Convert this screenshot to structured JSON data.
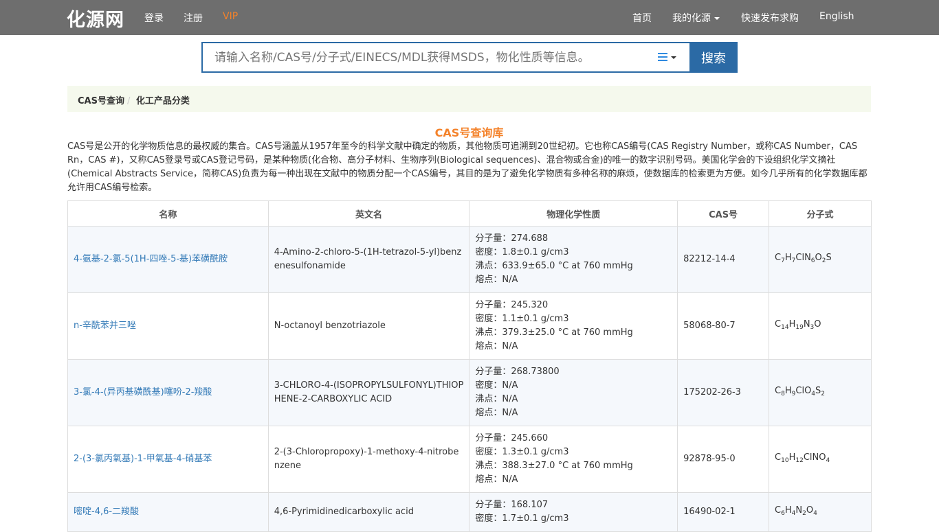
{
  "header": {
    "logo": "化源网",
    "nav_left": [
      "登录",
      "注册",
      "VIP"
    ],
    "nav_right": [
      "首页",
      "我的化源",
      "快速发布求购",
      "English"
    ]
  },
  "search": {
    "placeholder": "请输入名称/CAS号/分子式/EINECS/MDL获得MSDS，物化性质等信息。",
    "button": "搜索"
  },
  "breadcrumb": [
    "CAS号查询",
    "化工产品分类"
  ],
  "page_title": "CAS号查询库",
  "intro": "CAS号是公开的化学物质信息的最权威的集合。CAS号涵盖从1957年至今的科学文献中确定的物质，其他物质可追溯到20世纪初。它也称CAS编号(CAS Registry Number，或称CAS Number，CAS Rn，CAS #)，又称CAS登录号或CAS登记号码，是某种物质(化合物、高分子材料、生物序列(Biological sequences)、混合物或合金)的唯一的数字识别号码。美国化学会的下设组织化学文摘社(Chemical Abstracts Service，简称CAS)负责为每一种出现在文献中的物质分配一个CAS编号，其目的是为了避免化学物质有多种名称的麻烦，使数据库的检索更为方便。如今几乎所有的化学数据库都允许用CAS编号检索。",
  "table": {
    "headers": [
      "名称",
      "英文名",
      "物理化学性质",
      "CAS号",
      "分子式"
    ],
    "rows": [
      {
        "name": "4-氨基-2-氯-5(1H-四唑-5-基)苯磺酰胺",
        "english": "4-Amino-2-chloro-5-(1H-tetrazol-5-yl)benzenesulfonamide",
        "mw": "分子量：274.688",
        "density": "密度：1.8±0.1 g/cm3",
        "bp": "沸点：633.9±65.0 °C at 760 mmHg",
        "mp": "熔点：N/A",
        "cas": "82212-14-4",
        "formula": "C<sub>7</sub>H<sub>7</sub>ClN<sub>6</sub>O<sub>2</sub>S"
      },
      {
        "name": "n-辛酰苯并三唑",
        "english": "N-octanoyl benzotriazole",
        "mw": "分子量：245.320",
        "density": "密度：1.1±0.1 g/cm3",
        "bp": "沸点：379.3±25.0 °C at 760 mmHg",
        "mp": "熔点：N/A",
        "cas": "58068-80-7",
        "formula": "C<sub>14</sub>H<sub>19</sub>N<sub>3</sub>O"
      },
      {
        "name": "3-氯-4-(异丙基磺酰基)噻吩-2-羧酸",
        "english": "3-CHLORO-4-(ISOPROPYLSULFONYL)THIOPHENE-2-CARBOXYLIC ACID",
        "mw": "分子量：268.73800",
        "density": "密度：N/A",
        "bp": "沸点：N/A",
        "mp": "熔点：N/A",
        "cas": "175202-26-3",
        "formula": "C<sub>8</sub>H<sub>9</sub>ClO<sub>4</sub>S<sub>2</sub>"
      },
      {
        "name": "2-(3-氯丙氧基)-1-甲氧基-4-硝基苯",
        "english": "2-(3-Chloropropoxy)-1-methoxy-4-nitrobenzene",
        "mw": "分子量：245.660",
        "density": "密度：1.3±0.1 g/cm3",
        "bp": "沸点：388.3±27.0 °C at 760 mmHg",
        "mp": "熔点：N/A",
        "cas": "92878-95-0",
        "formula": "C<sub>10</sub>H<sub>12</sub>ClNO<sub>4</sub>"
      },
      {
        "name": "嘧啶-4,6-二羧酸",
        "english": "4,6-Pyrimidinedicarboxylic acid",
        "mw": "分子量：168.107",
        "density": "密度：1.7±0.1 g/cm3",
        "bp": "",
        "mp": "",
        "cas": "16490-02-1",
        "formula": "C<sub>6</sub>H<sub>4</sub>N<sub>2</sub>O<sub>4</sub>"
      }
    ]
  }
}
